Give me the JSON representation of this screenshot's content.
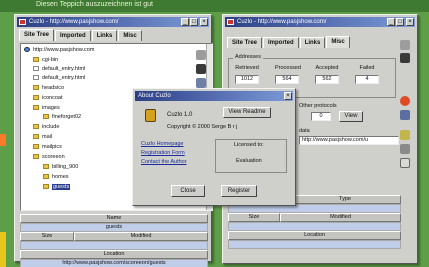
{
  "top_caption": "Diesen Teppich auszuzeichnen ist gut",
  "left_window": {
    "title": "Cuzlo - http://www.pasjshow.com/",
    "tabs": [
      "Site Tree",
      "Imported",
      "Links",
      "Misc"
    ],
    "tree": [
      "http://www.pasjshow.com",
      "cgi-bin",
      "default_entry.html",
      "default_entry.html",
      "headsico",
      "iconcoat",
      "images",
      "fineforget02",
      "include",
      "mail",
      "mailpics",
      "scoreeon",
      "billing_900",
      "homes",
      "guests"
    ],
    "grid": {
      "name_header": "Name",
      "name_value": "guests",
      "size_header": "Size",
      "modified_header": "Modified",
      "location_header": "Location",
      "location_value": "http://www.pasjshow.com/scoreeon/guests"
    }
  },
  "right_window": {
    "title": "Cuzlo - http://www.pasjshow.com/",
    "tabs": [
      "Site Tree",
      "Imported",
      "Links",
      "Misc"
    ],
    "addresses": {
      "label": "Addresses",
      "columns": [
        "Retrieved",
        "Processed",
        "Accepted",
        "Failed"
      ],
      "values": [
        "1012",
        "564",
        "562",
        "4"
      ]
    },
    "other_protocols_label": "Other protocols",
    "other_protocols_value": "0",
    "view_button": "View",
    "data_label": "data",
    "url_value": "http://www.pasjshow.com/u",
    "grid": {
      "type_header": "Type",
      "size_header": "Size",
      "modified_header": "Modified",
      "location_header": "Location"
    }
  },
  "about_dialog": {
    "title": "About Cuzlo",
    "version": "Cuzlo 1.0",
    "view_readme_button": "View Readme",
    "copyright": "Copyright © 2000 Serge B r j",
    "links": [
      "Cuzlo Homepage",
      "Registration Form",
      "Contact the Author"
    ],
    "licensed_to_label": "Licensed to:",
    "licensed_to_value": "Evaluation",
    "close_button": "Close",
    "register_button": "Register"
  },
  "colors": {
    "background": "#5e9e48",
    "title_bar_start": "#2c3f86",
    "title_bar_end": "#7d9bd8",
    "selection": "#2a3d8f",
    "grid_row": "#bfcde9"
  }
}
